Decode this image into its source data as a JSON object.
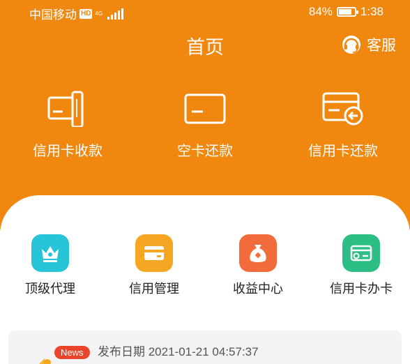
{
  "status_bar": {
    "carrier": "中国移动",
    "hd": "HD",
    "network": "4G",
    "battery_percent": "84%",
    "battery_level": 0.84,
    "time": "1:38"
  },
  "header": {
    "title": "首页",
    "service_label": "客服",
    "service_icon": "headset-icon"
  },
  "top_actions": [
    {
      "label": "信用卡收款",
      "icon": "card-swipe-icon"
    },
    {
      "label": "空卡还款",
      "icon": "card-icon"
    },
    {
      "label": "信用卡还款",
      "icon": "card-repay-icon"
    }
  ],
  "menu": [
    {
      "label": "顶级代理",
      "icon": "crown-icon",
      "color": "#26C4D6"
    },
    {
      "label": "信用管理",
      "icon": "card-manage-icon",
      "color": "#F5A623"
    },
    {
      "label": "收益中心",
      "icon": "money-bag-icon",
      "color": "#F26B3A"
    },
    {
      "label": "信用卡办卡",
      "icon": "card-apply-icon",
      "color": "#2DBE86"
    }
  ],
  "news": {
    "badge": "News",
    "date": "发布日期 2021-01-21 04:57:37",
    "icon": "announcement-icon"
  },
  "colors": {
    "brand": "#F0870E",
    "news_badge": "#E8452B"
  }
}
